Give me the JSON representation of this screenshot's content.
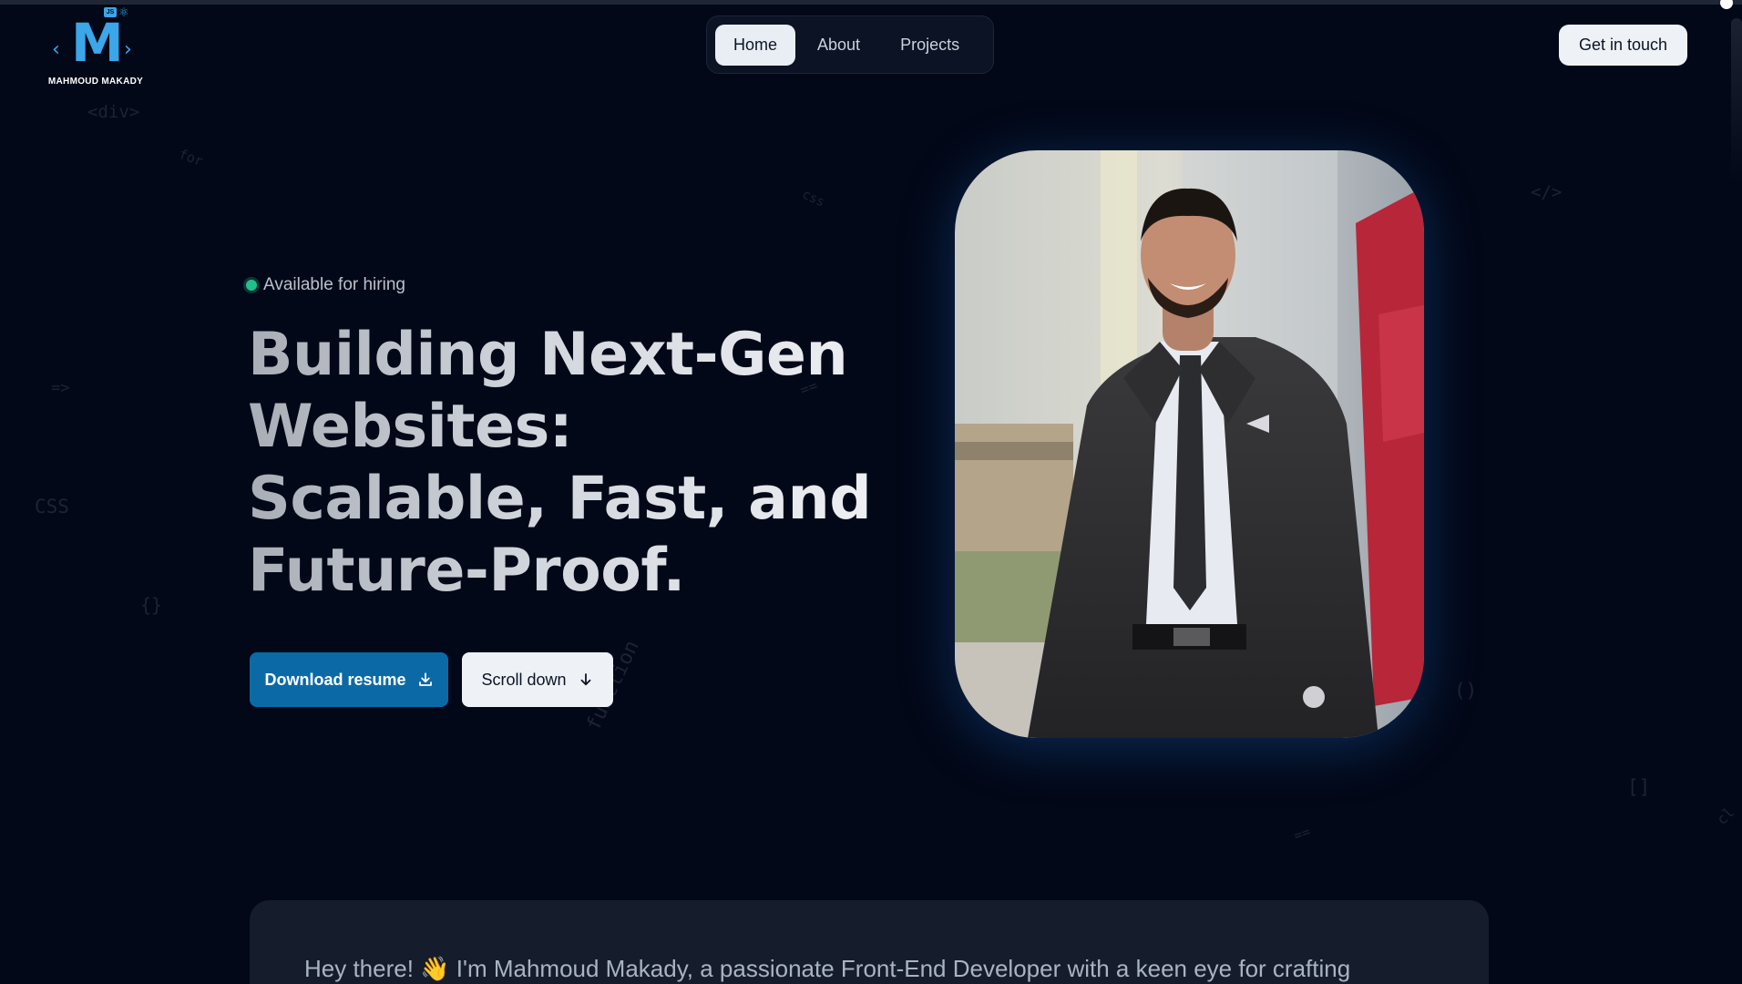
{
  "brand": {
    "monogram": "M",
    "badge": "JS",
    "name": "MAHMOUD MAKADY"
  },
  "nav": {
    "items": [
      {
        "label": "Home",
        "active": true
      },
      {
        "label": "About",
        "active": false
      },
      {
        "label": "Projects",
        "active": false
      }
    ]
  },
  "header": {
    "cta_label": "Get in touch"
  },
  "decorations": {
    "div": "<div>",
    "for": "for",
    "css_small": "css",
    "close_tag": "</>",
    "arrow": "=>",
    "eq": "==",
    "css": "CSS",
    "braces": "{}",
    "function": "function",
    "parens": "()",
    "brackets": "[]",
    "eq2": "==",
    "cl": "cl"
  },
  "hero": {
    "status": "Available for hiring",
    "status_color": "#22c08a",
    "headline": "Building Next-Gen Websites: Scalable, Fast, and Future-Proof.",
    "primary_button": "Download resume",
    "primary_icon": "download-icon",
    "secondary_button": "Scroll down",
    "secondary_icon": "arrow-down-icon"
  },
  "intro": {
    "text": "Hey there! 👋 I'm Mahmoud Makady, a passionate Front-End Developer with a keen eye for crafting"
  },
  "colors": {
    "background": "#030818",
    "accent": "#0b6aa6",
    "brand_blue": "#3ba6e8"
  }
}
